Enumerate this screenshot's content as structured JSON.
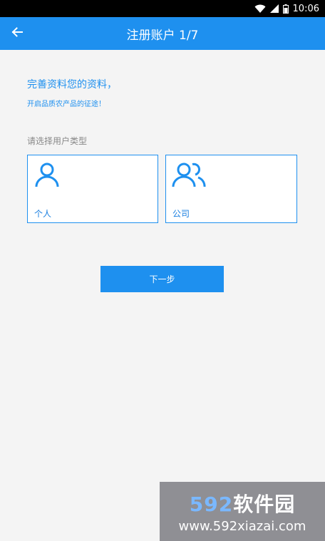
{
  "status_bar": {
    "time": "10:06"
  },
  "toolbar": {
    "title": "注册账户 1/7",
    "back_icon": "arrow-left-icon"
  },
  "intro": {
    "title": "完善资料您的资料，",
    "subtitle": "开启品质农产品的征途！"
  },
  "user_type": {
    "label": "请选择用户类型",
    "options": [
      {
        "label": "个人",
        "icon": "person-icon"
      },
      {
        "label": "公司",
        "icon": "people-icon"
      }
    ]
  },
  "actions": {
    "next_label": "下一步"
  },
  "watermark": {
    "logo_number": "592",
    "logo_text": "软件园",
    "url": "www.592xiazai.com"
  },
  "colors": {
    "accent": "#1e90ef",
    "background": "#f4f4f4"
  }
}
